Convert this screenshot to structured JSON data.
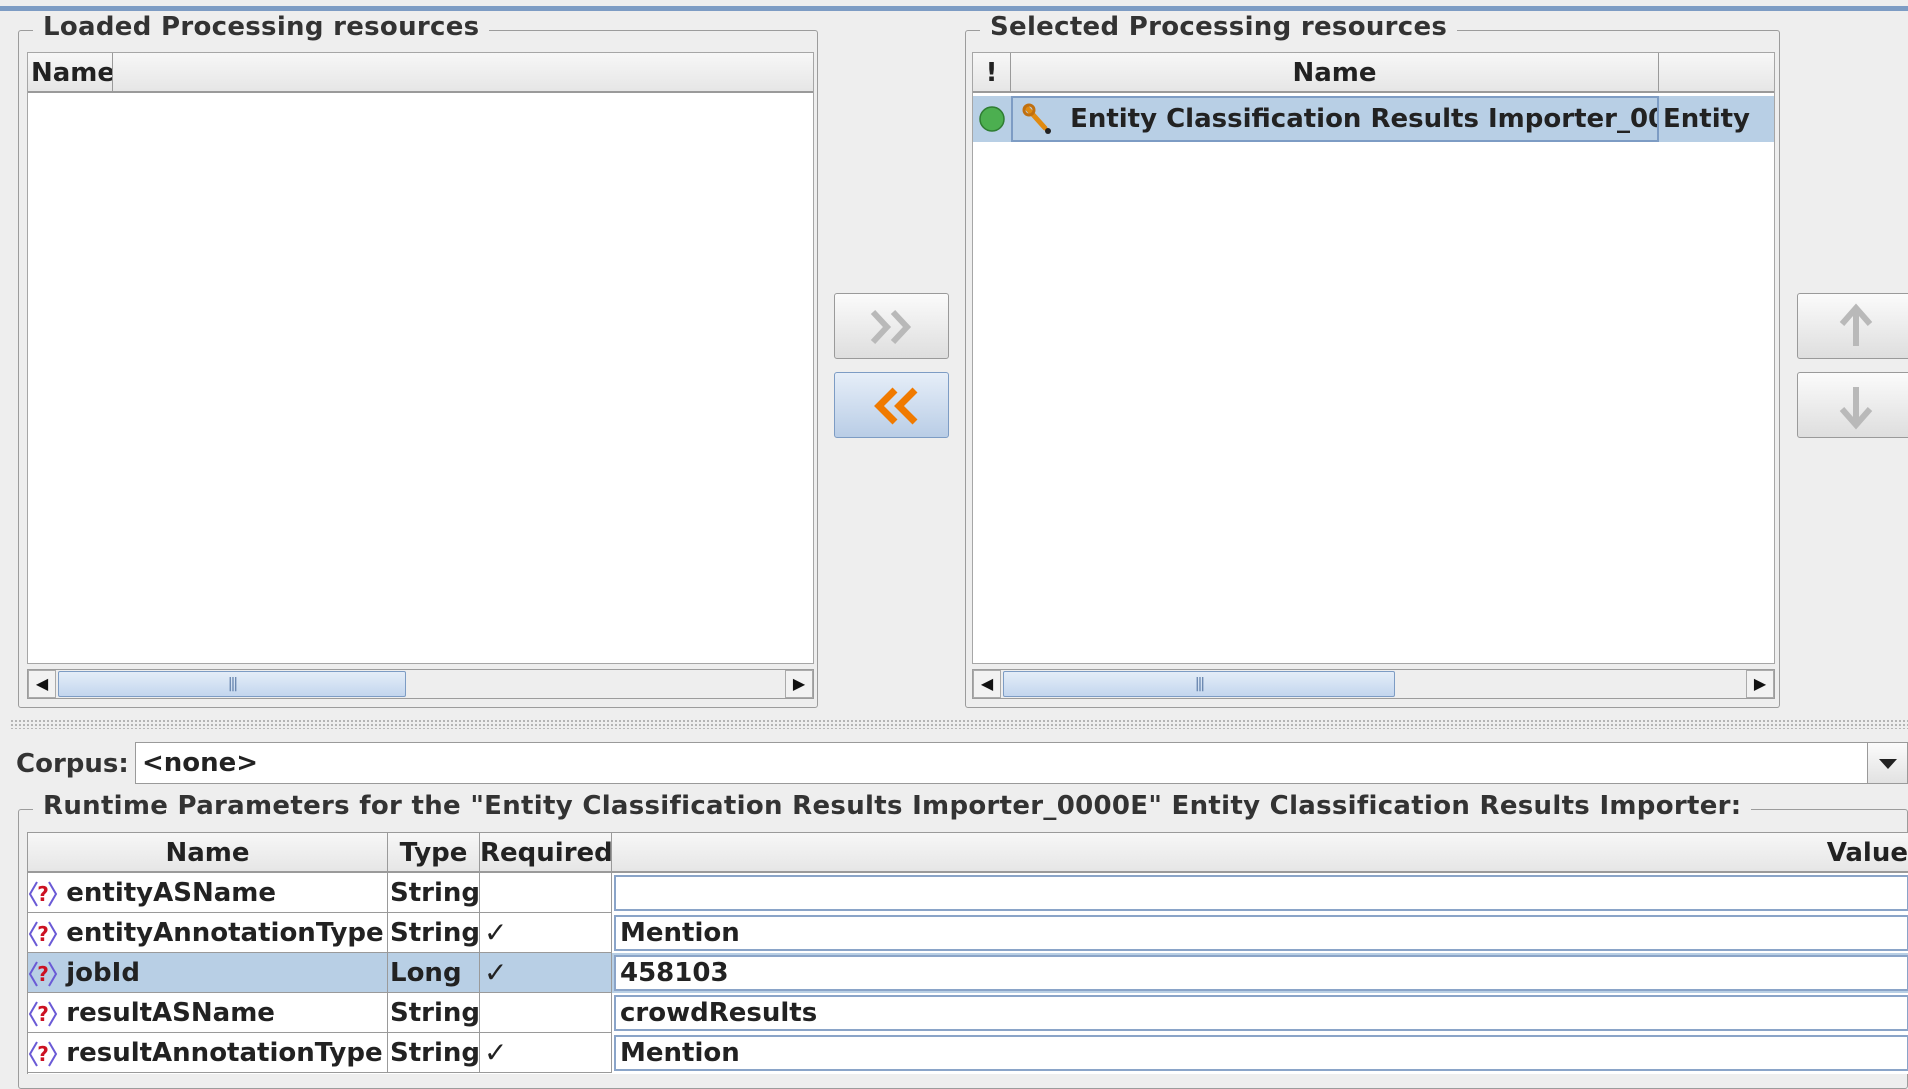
{
  "loaded": {
    "title": "Loaded Processing resources",
    "column_name": "Name"
  },
  "selected": {
    "title": "Selected Processing resources",
    "column_flag": "!",
    "column_name": "Name",
    "rows": [
      {
        "name": "Entity Classification Results Importer_00...",
        "type": "Entity",
        "status": "green-dot-icon"
      }
    ]
  },
  "corpus": {
    "label": "Corpus:",
    "value": "<none>"
  },
  "runtime": {
    "title": "Runtime Parameters for the \"Entity Classification Results Importer_0000E\" Entity Classification Results Importer:",
    "headers": {
      "name": "Name",
      "type": "Type",
      "required": "Required",
      "value": "Value"
    },
    "rows": [
      {
        "name": "entityASName",
        "type": "String",
        "required": "",
        "value": ""
      },
      {
        "name": "entityAnnotationType",
        "type": "String",
        "required": "✓",
        "value": "Mention"
      },
      {
        "name": "jobId",
        "type": "Long",
        "required": "✓",
        "value": "458103"
      },
      {
        "name": "resultASName",
        "type": "String",
        "required": "",
        "value": "crowdResults"
      },
      {
        "name": "resultAnnotationType",
        "type": "String",
        "required": "✓",
        "value": "Mention"
      }
    ],
    "selected_row": "jobId"
  },
  "colors": {
    "accent_orange": "#f07a00",
    "selection_blue": "#b8cfe5",
    "status_green": "#4caf50",
    "param_icon_red": "#cc1122"
  }
}
